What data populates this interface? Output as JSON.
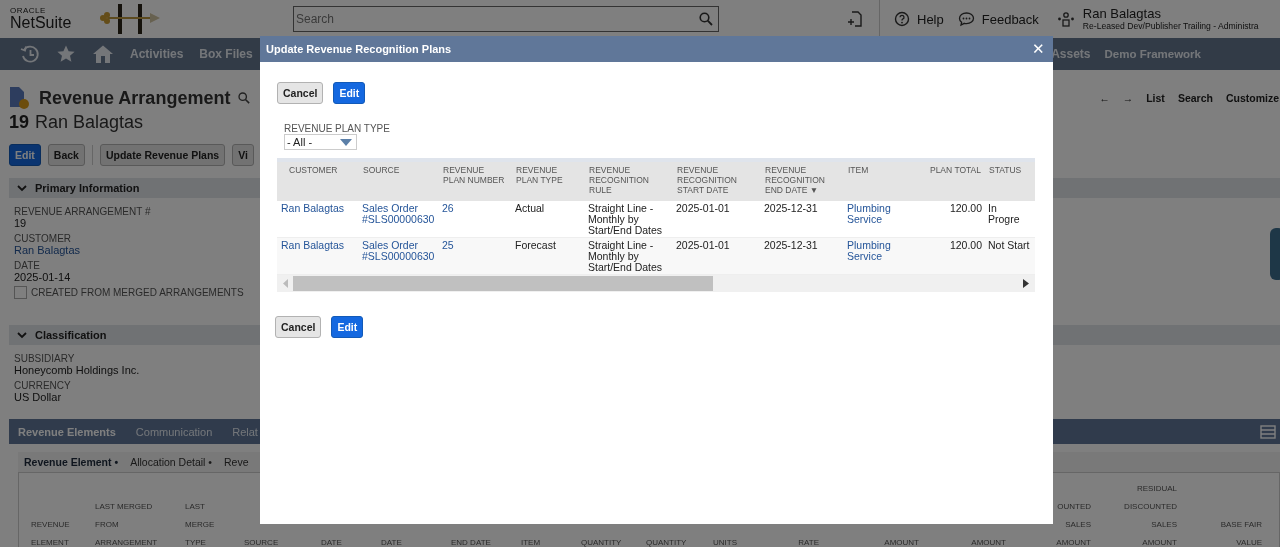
{
  "header": {
    "brand_top": "ORACLE",
    "brand": "NetSuite",
    "search": {
      "placeholder": "Search"
    },
    "help": "Help",
    "feedback": "Feedback",
    "user_name": "Ran Balagtas",
    "user_role": "Re-Leased Dev/Publisher Trailing - Administra"
  },
  "nav": {
    "items": [
      "Activities",
      "Box Files"
    ],
    "right_items": [
      "Assets",
      "Demo Framework"
    ]
  },
  "page": {
    "record_type": "Revenue Arrangement",
    "record_number": "19",
    "record_name": "Ran Balagtas",
    "buttons": [
      {
        "label": "Edit",
        "kind": "primary"
      },
      {
        "label": "Back",
        "kind": "secondary"
      },
      {
        "label": "Update Revenue Plans",
        "kind": "secondary"
      },
      {
        "label": "Vi",
        "kind": "secondary"
      }
    ],
    "record_nav": [
      "←",
      "→",
      "List",
      "Search",
      "Customize"
    ],
    "sections": [
      {
        "title": "Primary Information",
        "fields": [
          {
            "label": "REVENUE ARRANGEMENT #",
            "value": "19",
            "kind": "text"
          },
          {
            "label": "CUSTOMER",
            "value": "Ran Balagtas",
            "kind": "link"
          },
          {
            "label": "DATE",
            "value": "2025-01-14",
            "kind": "text"
          },
          {
            "label": "CREATED FROM MERGED ARRANGEMENTS",
            "kind": "checkbox",
            "checked": false
          }
        ]
      },
      {
        "title": "Classification",
        "fields": [
          {
            "label": "SUBSIDIARY",
            "value": "Honeycomb Holdings Inc.",
            "kind": "text"
          },
          {
            "label": "CURRENCY",
            "value": "US Dollar",
            "kind": "text"
          }
        ]
      }
    ],
    "tabs": [
      {
        "label": "Revenue Elements",
        "selected": true
      },
      {
        "label": "Communication",
        "selected": false
      },
      {
        "label": "Relat",
        "selected": false
      }
    ],
    "subtabs": [
      {
        "label": "Revenue Element •",
        "selected": true
      },
      {
        "label": "Allocation Detail •",
        "selected": false
      },
      {
        "label": "Reve",
        "selected": false
      }
    ],
    "element_columns": [
      {
        "lines": [
          "REVENUE",
          "ELEMENT"
        ]
      },
      {
        "lines": [
          "LAST MERGED",
          "FROM",
          "ARRANGEMENT"
        ]
      },
      {
        "lines": [
          "LAST",
          "MERGE",
          "TYPE"
        ]
      },
      {
        "lines": [
          "SOURCE"
        ]
      },
      {
        "lines": [
          "DATE"
        ]
      },
      {
        "lines": [
          "DATE"
        ]
      },
      {
        "lines": [
          "END DATE"
        ]
      },
      {
        "lines": [
          "ITEM"
        ]
      },
      {
        "lines": [
          "QUANTITY"
        ]
      },
      {
        "lines": [
          "QUANTITY"
        ]
      },
      {
        "lines": [
          "UNITS"
        ]
      },
      {
        "lines": [
          "RATE"
        ]
      },
      {
        "lines": [
          "AMOUNT"
        ]
      },
      {
        "lines": [
          "AMOUNT"
        ]
      },
      {
        "lines": [
          "OUNTED",
          "SALES",
          "AMOUNT"
        ]
      },
      {
        "lines": [
          "RESIDUAL",
          "DISCOUNTED",
          "SALES",
          "AMOUNT"
        ]
      },
      {
        "lines": [
          "BASE FAIR",
          "VALUE"
        ]
      }
    ]
  },
  "modal": {
    "title": "Update Revenue Recognition Plans",
    "close": "✕",
    "top_buttons": [
      {
        "label": "Cancel",
        "kind": "secondary"
      },
      {
        "label": "Edit",
        "kind": "primary"
      }
    ],
    "filter": {
      "label": "REVENUE PLAN TYPE",
      "value": "- All -"
    },
    "columns": [
      {
        "label": "CUSTOMER"
      },
      {
        "label": "SOURCE"
      },
      {
        "label": "REVENUE PLAN NUMBER"
      },
      {
        "label": "REVENUE PLAN TYPE"
      },
      {
        "label": "REVENUE RECOGNITION RULE"
      },
      {
        "label": "REVENUE RECOGNITION START DATE"
      },
      {
        "label": "REVENUE RECOGNITION END DATE",
        "sort": "▼"
      },
      {
        "label": "ITEM"
      },
      {
        "label": "PLAN TOTAL"
      },
      {
        "label": "STATUS"
      }
    ],
    "rows": [
      {
        "cells": [
          {
            "text": "Ran Balagtas",
            "kind": "link"
          },
          {
            "text": "Sales Order #SLS00000630",
            "kind": "link"
          },
          {
            "text": "26",
            "kind": "link"
          },
          {
            "text": "Actual",
            "kind": "text"
          },
          {
            "text": "Straight Line - Monthly by Start/End Dates",
            "kind": "text"
          },
          {
            "text": "2025-01-01",
            "kind": "text"
          },
          {
            "text": "2025-12-31",
            "kind": "text"
          },
          {
            "text": "Plumbing Service",
            "kind": "link"
          },
          {
            "text": "120.00",
            "kind": "text"
          },
          {
            "text": "In Progre",
            "kind": "text"
          }
        ]
      },
      {
        "cells": [
          {
            "text": "Ran Balagtas",
            "kind": "link"
          },
          {
            "text": "Sales Order #SLS00000630",
            "kind": "link"
          },
          {
            "text": "25",
            "kind": "link"
          },
          {
            "text": "Forecast",
            "kind": "text"
          },
          {
            "text": "Straight Line - Monthly by Start/End Dates",
            "kind": "text"
          },
          {
            "text": "2025-01-01",
            "kind": "text"
          },
          {
            "text": "2025-12-31",
            "kind": "text"
          },
          {
            "text": "Plumbing Service",
            "kind": "link"
          },
          {
            "text": "120.00",
            "kind": "text"
          },
          {
            "text": "Not Start",
            "kind": "text"
          }
        ]
      }
    ],
    "bottom_buttons": [
      {
        "label": "Cancel",
        "kind": "secondary"
      },
      {
        "label": "Edit",
        "kind": "primary"
      }
    ]
  }
}
